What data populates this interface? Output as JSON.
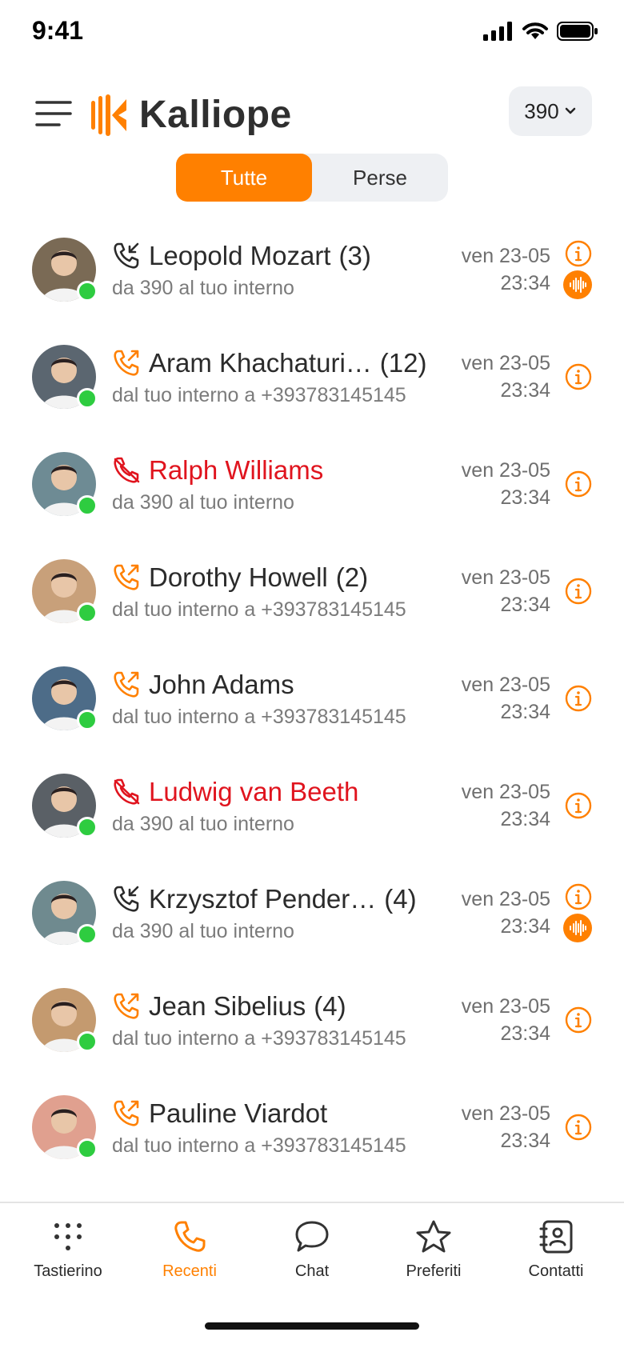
{
  "status_bar": {
    "time": "9:41"
  },
  "header": {
    "logo_text": "Kalliope",
    "extension": "390",
    "brand_color": "#ff8000"
  },
  "segmented": {
    "all_label": "Tutte",
    "missed_label": "Perse",
    "selected": "Tutte"
  },
  "calls": [
    {
      "name": "Leopold Mozart",
      "count": "(3)",
      "direction": "incoming",
      "subtitle": "da 390 al tuo interno",
      "date": "ven 23-05",
      "time": "23:34",
      "has_recording": true,
      "avatar_color": "#7a6a55"
    },
    {
      "name": "Aram Khachaturi…",
      "count": "(12)",
      "direction": "outgoing",
      "subtitle": "dal tuo interno a +393783145145",
      "date": "ven 23-05",
      "time": "23:34",
      "has_recording": false,
      "avatar_color": "#5b6670"
    },
    {
      "name": "Ralph Williams",
      "count": "",
      "direction": "missed",
      "subtitle": "da 390 al tuo interno",
      "date": "ven 23-05",
      "time": "23:34",
      "has_recording": false,
      "avatar_color": "#6e8b94"
    },
    {
      "name": "Dorothy Howell",
      "count": "(2)",
      "direction": "outgoing",
      "subtitle": "dal tuo interno a +393783145145",
      "date": "ven 23-05",
      "time": "23:34",
      "has_recording": false,
      "avatar_color": "#c8a07a"
    },
    {
      "name": "John Adams",
      "count": "",
      "direction": "outgoing",
      "subtitle": "dal tuo interno a +393783145145",
      "date": "ven 23-05",
      "time": "23:34",
      "has_recording": false,
      "avatar_color": "#4d6c88"
    },
    {
      "name": "Ludwig van Beeth",
      "count": "",
      "direction": "missed",
      "subtitle": "da 390 al tuo interno",
      "date": "ven 23-05",
      "time": "23:34",
      "has_recording": false,
      "avatar_color": "#5a6066"
    },
    {
      "name": "Krzysztof Pender…",
      "count": "(4)",
      "direction": "incoming",
      "subtitle": "da 390 al tuo interno",
      "date": "ven 23-05",
      "time": "23:34",
      "has_recording": true,
      "avatar_color": "#6f8a8f"
    },
    {
      "name": "Jean Sibelius",
      "count": "(4)",
      "direction": "outgoing",
      "subtitle": "dal tuo interno a +393783145145",
      "date": "ven 23-05",
      "time": "23:34",
      "has_recording": false,
      "avatar_color": "#c49a6f"
    },
    {
      "name": "Pauline Viardot",
      "count": "",
      "direction": "outgoing",
      "subtitle": "dal tuo interno a +393783145145",
      "date": "ven 23-05",
      "time": "23:34",
      "has_recording": false,
      "avatar_color": "#e0a08f"
    }
  ],
  "tabs": [
    {
      "label": "Tastierino",
      "icon": "keypad-icon",
      "active": false
    },
    {
      "label": "Recenti",
      "icon": "phone-icon",
      "active": true
    },
    {
      "label": "Chat",
      "icon": "chat-bubble-icon",
      "active": false
    },
    {
      "label": "Preferiti",
      "icon": "star-icon",
      "active": false
    },
    {
      "label": "Contatti",
      "icon": "contacts-book-icon",
      "active": false
    }
  ],
  "colors": {
    "accent": "#ff8000",
    "missed": "#e0141e",
    "presence": "#2ecc40"
  }
}
